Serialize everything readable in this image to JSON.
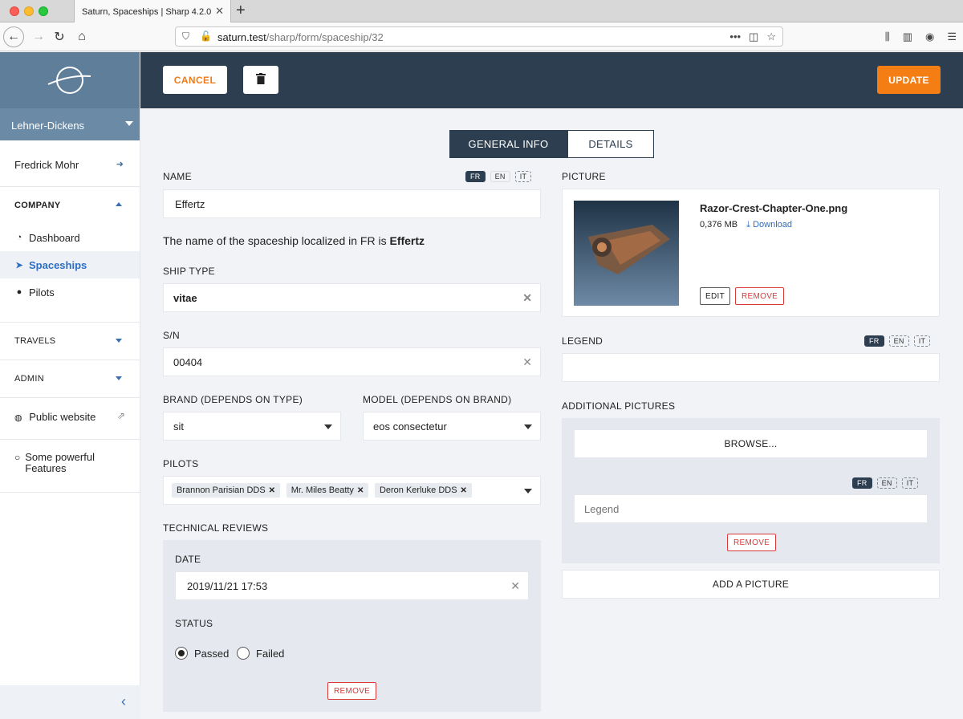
{
  "browser": {
    "tab_title": "Saturn, Spaceships | Sharp 4.2.0",
    "url_host": "saturn.test",
    "url_path": "/sharp/form/spaceship/32"
  },
  "sidebar": {
    "org": "Lehner-Dickens",
    "user": "Fredrick Mohr",
    "company_label": "COMPANY",
    "items": [
      {
        "label": "Dashboard",
        "icon": "dashboard-icon"
      },
      {
        "label": "Spaceships",
        "icon": "spaceship-icon"
      },
      {
        "label": "Pilots",
        "icon": "user-icon"
      }
    ],
    "travels_label": "TRAVELS",
    "admin_label": "ADMIN",
    "public_website": "Public website",
    "features": "Some powerful Features"
  },
  "toolbar": {
    "cancel": "CANCEL",
    "update": "UPDATE"
  },
  "tabs": [
    "GENERAL INFO",
    "DETAILS"
  ],
  "form": {
    "name_label": "NAME",
    "name_value": "Effertz",
    "locales": [
      "FR",
      "EN",
      "IT"
    ],
    "help_prefix": "The name of the spaceship localized in FR is ",
    "help_value": "Effertz",
    "ship_type_label": "SHIP TYPE",
    "ship_type_value": "vitae",
    "sn_label": "S/N",
    "sn_value": "00404",
    "brand_label": "BRAND (DEPENDS ON TYPE)",
    "brand_value": "sit",
    "model_label": "MODEL (DEPENDS ON BRAND)",
    "model_value": "eos consectetur",
    "pilots_label": "PILOTS",
    "pilots": [
      "Brannon Parisian DDS",
      "Mr. Miles Beatty",
      "Deron Kerluke DDS"
    ],
    "reviews_label": "TECHNICAL REVIEWS",
    "date_label": "DATE",
    "date_value": "2019/11/21 17:53",
    "status_label": "STATUS",
    "status_passed": "Passed",
    "status_failed": "Failed",
    "status_selected": "Passed",
    "remove": "REMOVE",
    "picture_label": "PICTURE",
    "picture_filename": "Razor-Crest-Chapter-One.png",
    "picture_size": "0,376 MB",
    "picture_download": "Download",
    "edit": "EDIT",
    "legend_label": "LEGEND",
    "additional_label": "ADDITIONAL PICTURES",
    "browse": "BROWSE...",
    "legend_placeholder": "Legend",
    "add_picture": "ADD A PICTURE"
  },
  "colors": {
    "accent": "#f57e14",
    "header": "#2d3e50",
    "sidebar_header": "#5f7e99",
    "link": "#2e6fc2",
    "danger": "#d83a3a"
  }
}
